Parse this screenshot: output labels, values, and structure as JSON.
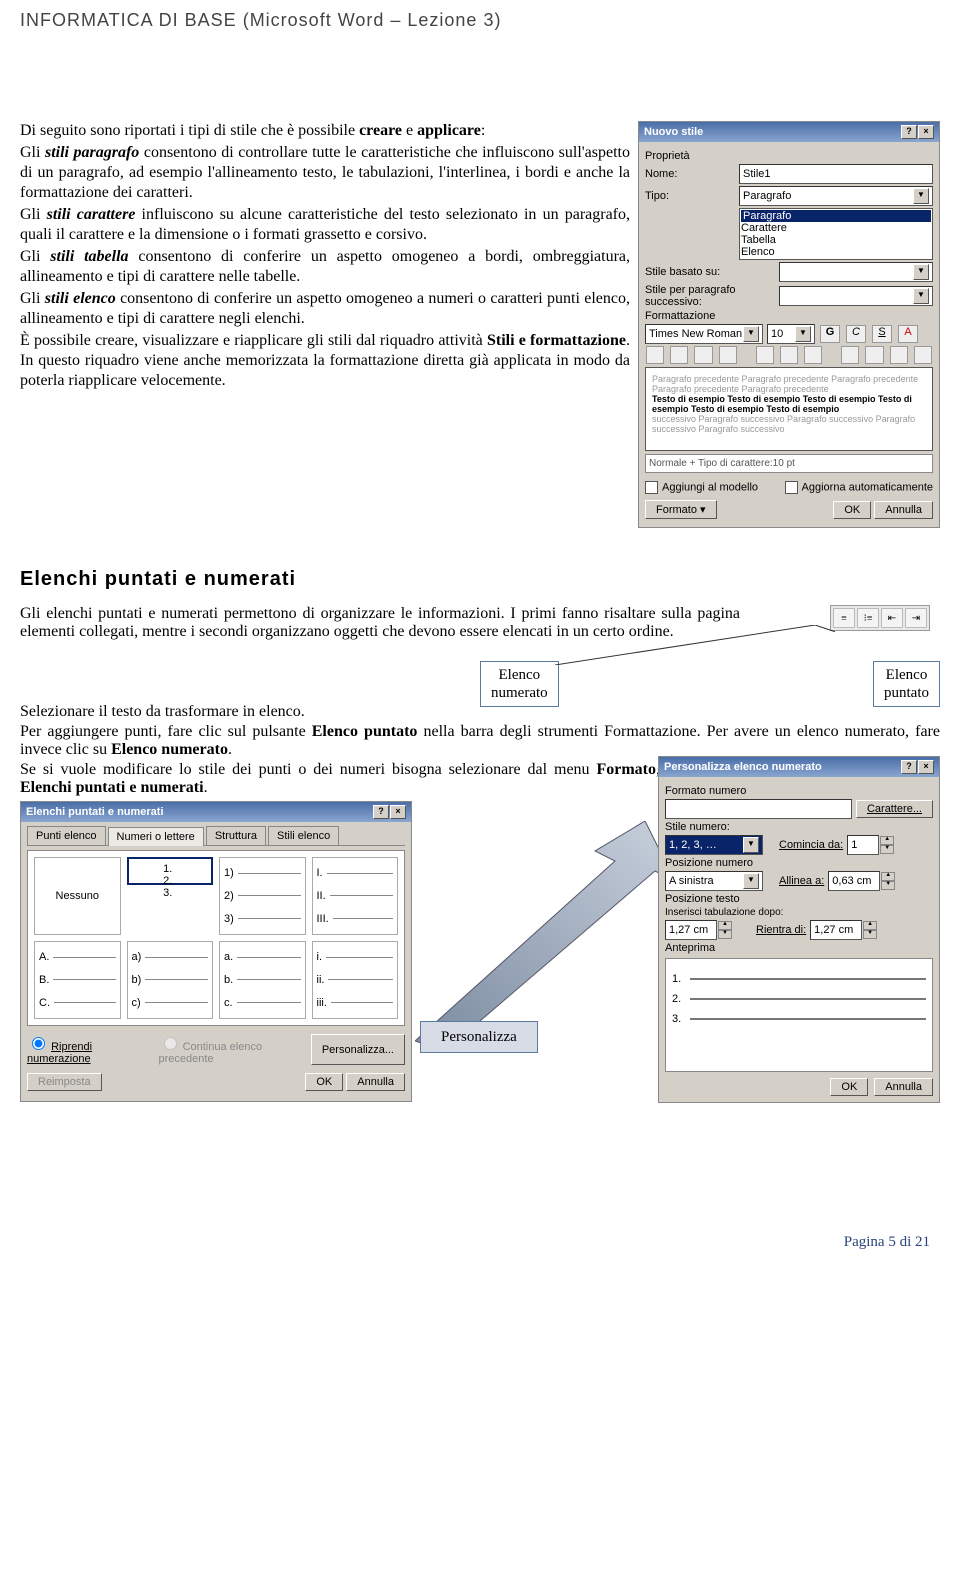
{
  "header": "INFORMATICA DI BASE (Microsoft Word – Lezione 3)",
  "intro": {
    "p1a": "Di seguito sono riportati i tipi di stile che è possibile ",
    "p1b": "creare",
    "p1c": " e ",
    "p1d": "applicare",
    "p1e": ":",
    "p2a": "Gli ",
    "p2b": "stili paragrafo",
    "p2c": " consentono di controllare tutte le caratteristiche che influiscono sull'aspetto di un paragrafo, ad esempio l'allineamento testo, le tabulazioni, l'interlinea, i bordi e anche la formattazione dei caratteri.",
    "p3a": "Gli ",
    "p3b": "stili carattere",
    "p3c": " influiscono su alcune caratteristiche del testo selezionato in un paragrafo, quali il carattere e la dimensione o i formati grassetto e corsivo.",
    "p4a": "Gli ",
    "p4b": "stili tabella",
    "p4c": " consentono di conferire un aspetto omogeneo a bordi, ombreggiatura, allineamento e tipi di carattere nelle tabelle.",
    "p5a": "Gli ",
    "p5b": "stili elenco",
    "p5c": " consentono di conferire un aspetto omogeneo a numeri o caratteri punti elenco, allineamento e tipi di carattere negli elenchi.",
    "p6a": "È possibile creare, visualizzare e riapplicare gli stili dal riquadro attività ",
    "p6b": "Stili e formattazione",
    "p6c": ". In questo riquadro viene anche memorizzata la formattazione diretta già applicata in modo da poterla riapplicare velocemente."
  },
  "nuovo_stile": {
    "title": "Nuovo stile",
    "props": "Proprietà",
    "nome_l": "Nome:",
    "nome_v": "Stile1",
    "tipo_l": "Tipo:",
    "tipo_v": "Paragrafo",
    "tipo_opts": [
      "Paragrafo",
      "Carattere",
      "Tabella",
      "Elenco"
    ],
    "basato_l": "Stile basato su:",
    "succ_l": "Stile per paragrafo successivo:",
    "form": "Formattazione",
    "font": "Times New Roman",
    "size": "10",
    "desc": "Normale + Tipo di carattere:10 pt",
    "cb1": "Aggiungi al modello",
    "cb2": "Aggiorna automaticamente",
    "formato": "Formato ▾",
    "ok": "OK",
    "annulla": "Annulla"
  },
  "section2": {
    "title": "Elenchi puntati e numerati",
    "p1": "Gli elenchi puntati e numerati permettono di organizzare le informazioni. I primi fanno risaltare sulla pagina elementi collegati, mentre i secondi organizzano oggetti che devono essere elencati in un certo ordine.",
    "tag1a": "Elenco",
    "tag1b": "numerato",
    "tag2a": "Elenco",
    "tag2b": "puntato",
    "p2": "Selezionare il testo da trasformare in elenco.",
    "p3a": "Per aggiungere punti, fare clic sul pulsante ",
    "p3b": "Elenco puntato",
    "p3c": " nella barra degli strumenti Formattazione. Per avere un elenco numerato, fare invece clic su ",
    "p3d": "Elenco numerato",
    "p3e": ".",
    "p4a": "Se si vuole modificare lo stile dei punti o dei numeri bisogna selezionare dal menu ",
    "p4b": "Formato",
    "p4c": ", ",
    "p4d": "Elenchi puntati e numerati",
    "p4e": "."
  },
  "list_dlg": {
    "title": "Elenchi puntati e numerati",
    "tabs": [
      "Punti elenco",
      "Numeri o lettere",
      "Struttura",
      "Stili elenco"
    ],
    "active_tab": 1,
    "cells": [
      {
        "label": "Nessuno"
      },
      {
        "items": [
          "1.",
          "2.",
          "3."
        ]
      },
      {
        "items": [
          "1)",
          "2)",
          "3)"
        ]
      },
      {
        "items": [
          "I.",
          "II.",
          "III."
        ]
      },
      {
        "items": [
          "A.",
          "B.",
          "C."
        ]
      },
      {
        "items": [
          "a)",
          "b)",
          "c)"
        ]
      },
      {
        "items": [
          "a.",
          "b.",
          "c."
        ]
      },
      {
        "items": [
          "i.",
          "ii.",
          "iii."
        ]
      }
    ],
    "r1": "Riprendi numerazione",
    "r2": "Continua elenco precedente",
    "pers": "Personalizza...",
    "reimp": "Reimposta",
    "ok": "OK",
    "annulla": "Annulla"
  },
  "pers_dlg": {
    "title": "Personalizza elenco numerato",
    "l1": "Formato numero",
    "carat": "Carattere...",
    "l2": "Stile numero:",
    "v2": "1, 2, 3, …",
    "l3": "Comincia da:",
    "v3": "1",
    "l4": "Posizione numero",
    "v4": "A sinistra",
    "l5": "Allinea a:",
    "v5": "0,63 cm",
    "l6": "Posizione testo",
    "l7": "Inserisci tabulazione dopo:",
    "v7": "1,27 cm",
    "l8": "Rientra di:",
    "v8": "1,27 cm",
    "l9": "Anteprima",
    "ok": "OK",
    "annulla": "Annulla"
  },
  "callout": "Personalizza",
  "footer": "Pagina 5 di 21"
}
